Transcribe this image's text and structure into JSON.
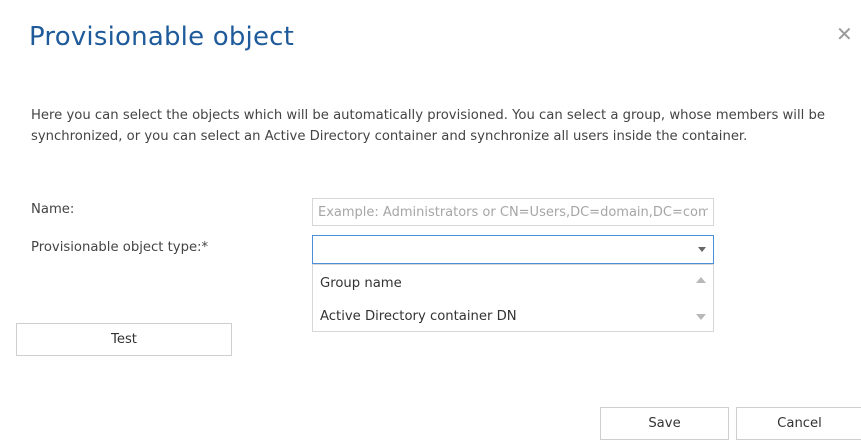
{
  "dialog": {
    "title": "Provisionable object",
    "close_icon": "close-icon",
    "description": "Here you can select the objects which will be automatically provisioned. You can select a group, whose members will be synchronized, or you can select an Active Directory container and synchronize all users inside the container."
  },
  "form": {
    "name_label": "Name:",
    "name_placeholder": "Example: Administrators or CN=Users,DC=domain,DC=com",
    "type_label": "Provisionable object type:*",
    "type_value": "",
    "type_options": [
      "Group name",
      "Active Directory container DN"
    ]
  },
  "buttons": {
    "test": "Test",
    "save": "Save",
    "cancel": "Cancel"
  },
  "colors": {
    "title": "#1f5b9a",
    "focus_border": "#4a90d9",
    "text": "#444444"
  }
}
